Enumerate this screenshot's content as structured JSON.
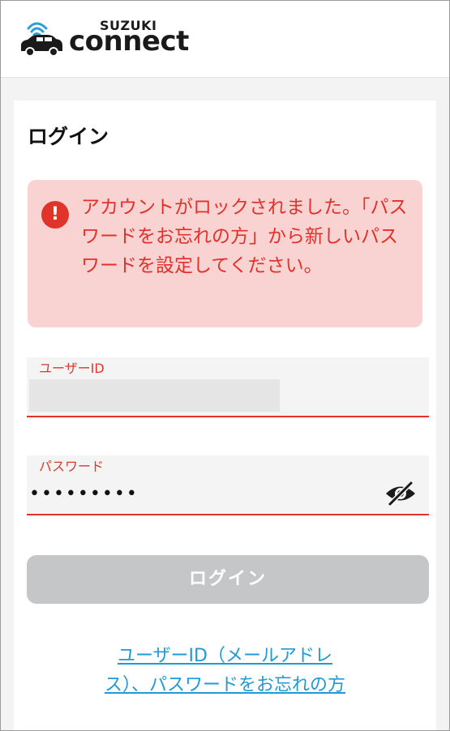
{
  "header": {
    "logo_brand": "SUZUKI",
    "logo_product": "connect",
    "logo_icon": "connected-car-icon"
  },
  "login": {
    "title": "ログイン",
    "alert": {
      "icon": "error-exclamation-icon",
      "message": "アカウントがロックされました。「パスワードをお忘れの方」から新しいパスワードを設定してください。"
    },
    "user_id": {
      "label": "ユーザーID",
      "value": ""
    },
    "password": {
      "label": "パスワード",
      "value": "•••••••••",
      "toggle_icon": "eye-off-icon"
    },
    "submit_label": "ログイン",
    "forgot_link": {
      "line1": "ユーザーID（メールアドレ",
      "line2": "ス）、パスワードをお忘れの方"
    }
  },
  "colors": {
    "error": "#e0332a",
    "alert_background": "#f9d3d2",
    "disabled_button": "#c5c6c8",
    "link": "#1f9ad6"
  }
}
